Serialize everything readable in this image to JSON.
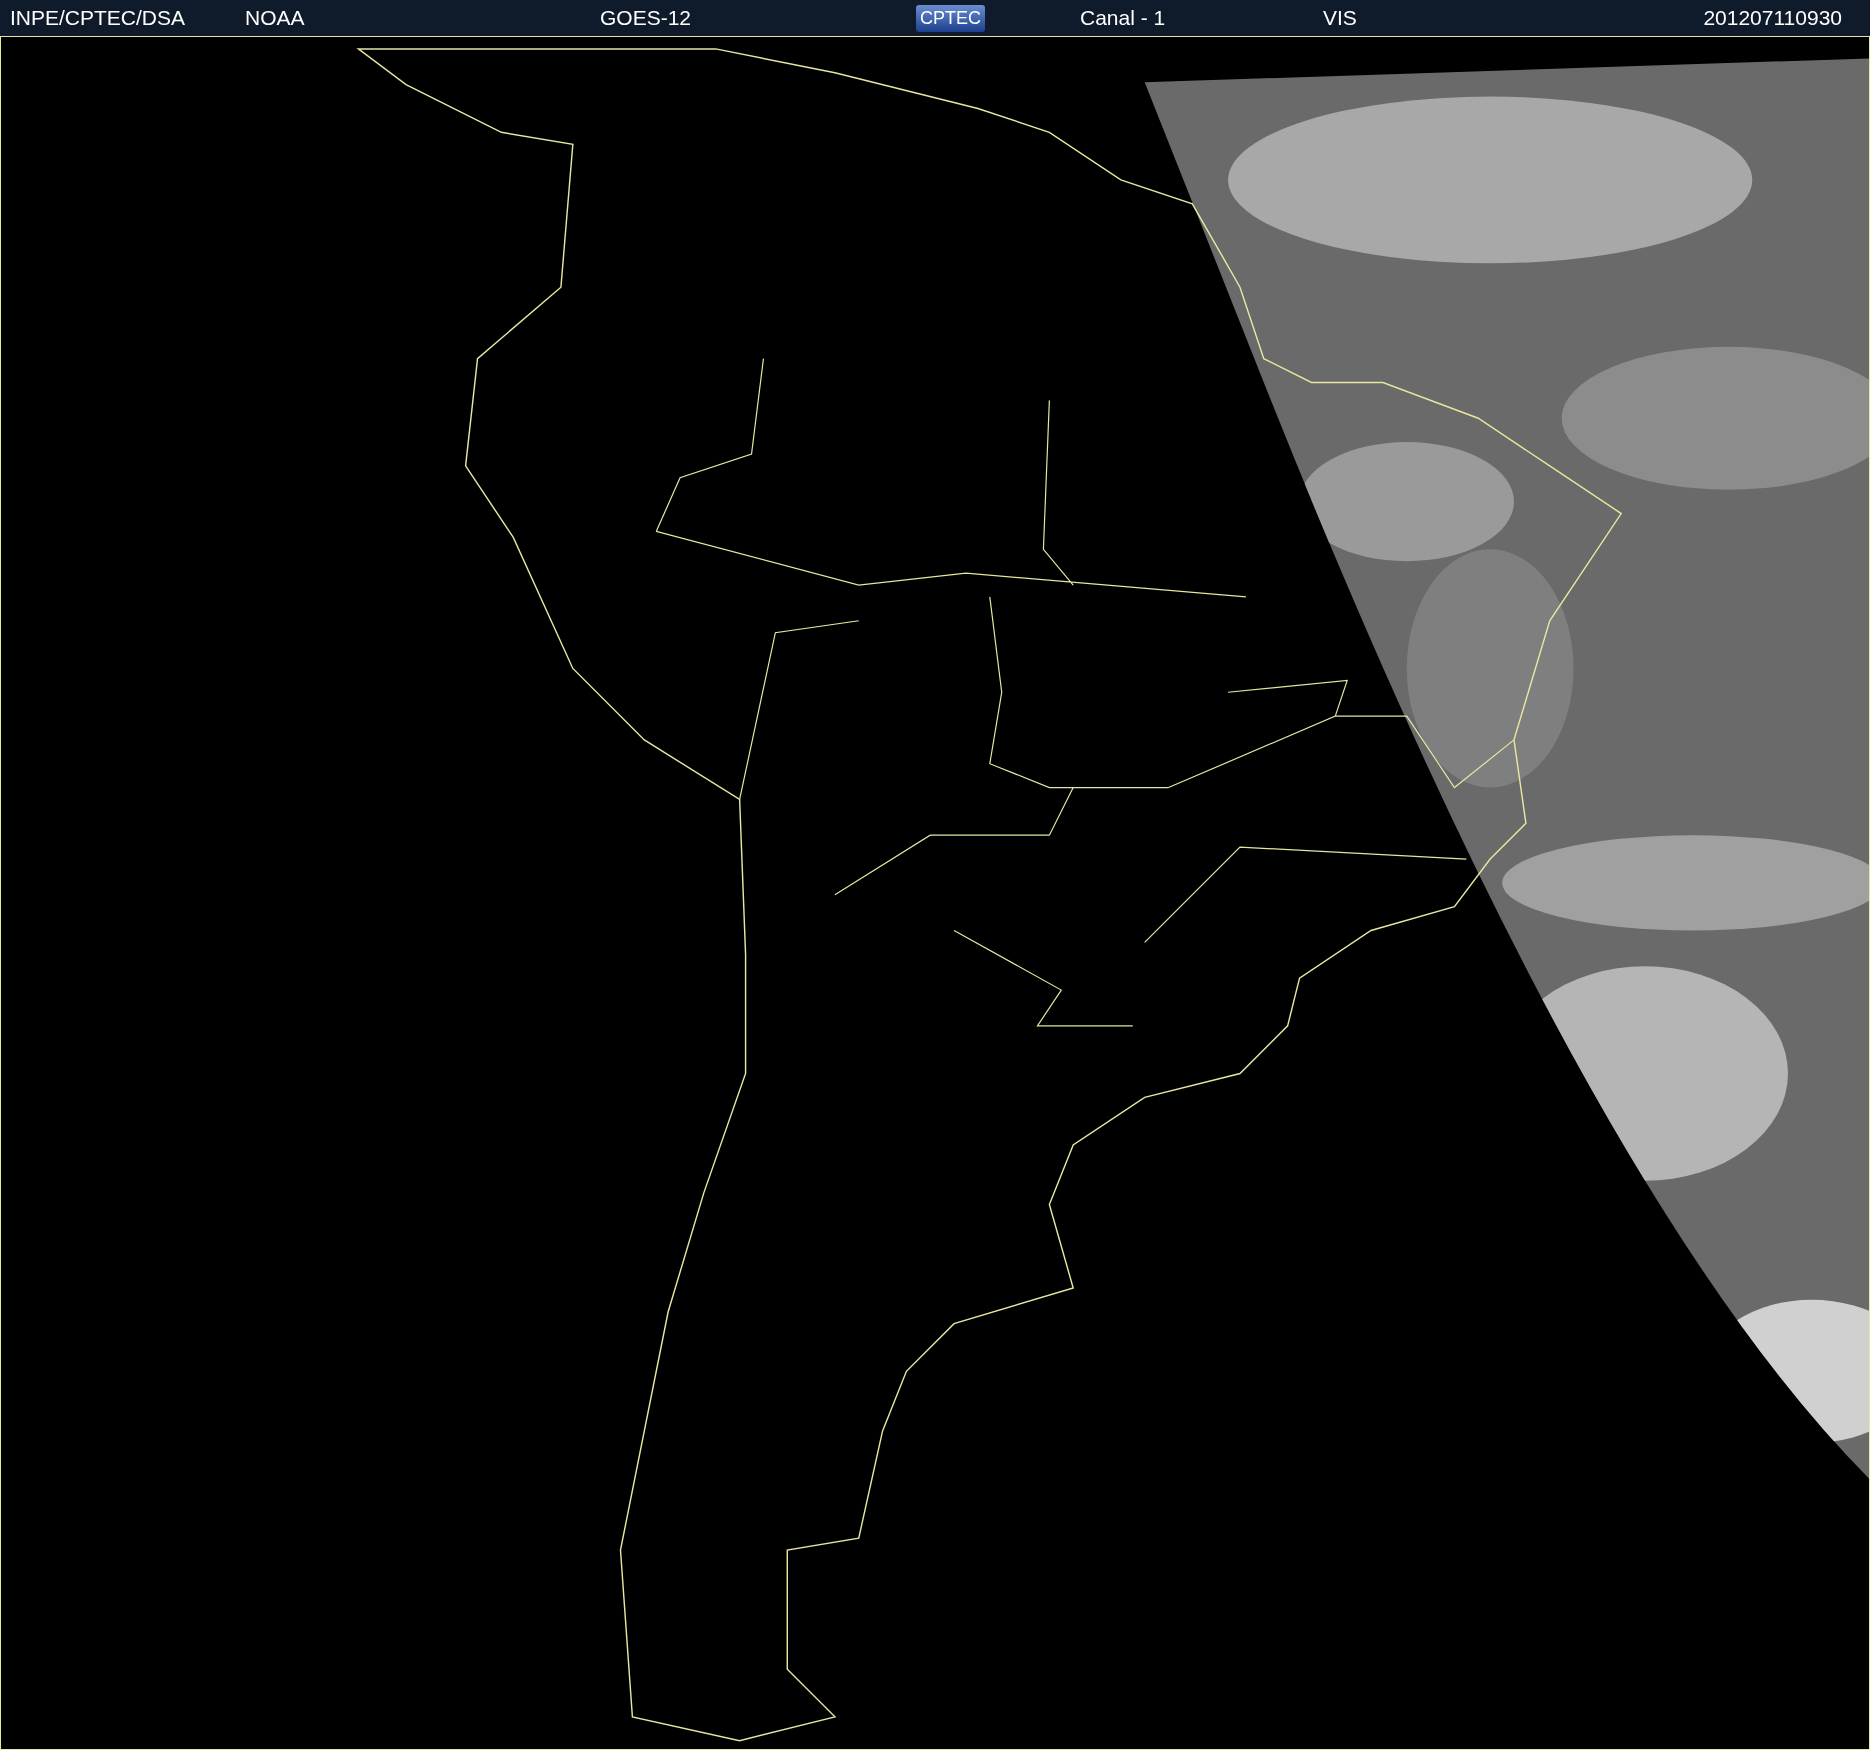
{
  "header": {
    "source": "INPE/CPTEC/DSA",
    "agency": "NOAA",
    "satellite": "GOES-12",
    "logo": "CPTEC",
    "channel": "Canal - 1",
    "band": "VIS",
    "timestamp": "201207110930"
  }
}
